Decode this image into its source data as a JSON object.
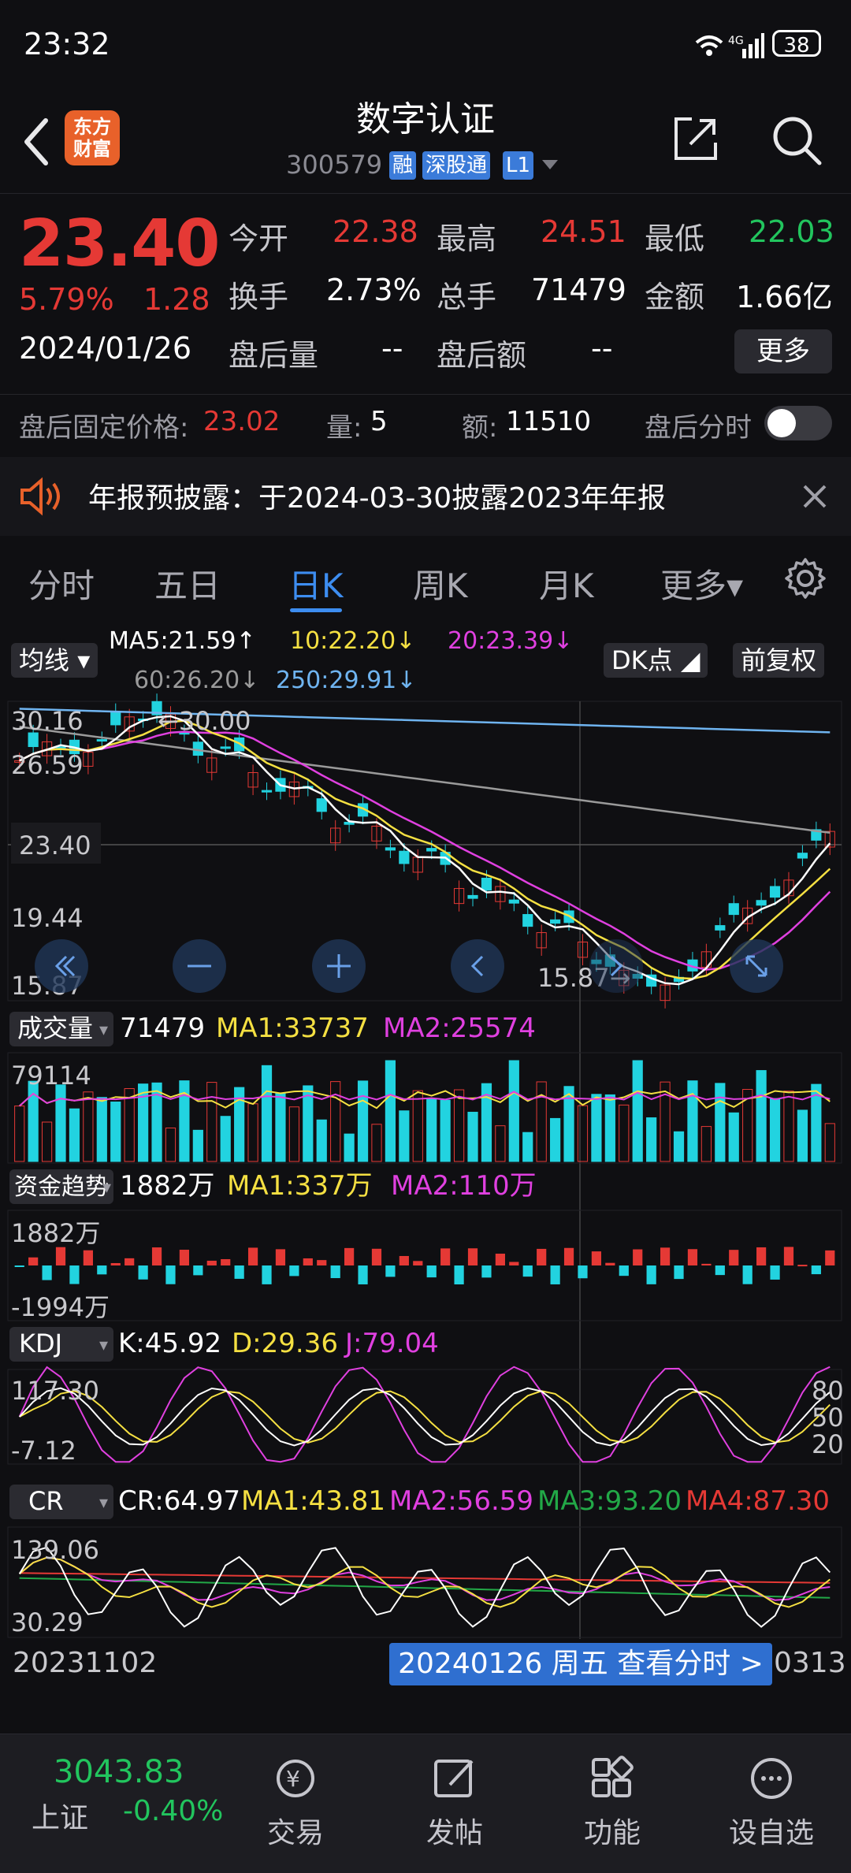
{
  "status": {
    "time": "23:32",
    "network": "4G",
    "battery": "38"
  },
  "header": {
    "title": "数字认证",
    "code": "300579",
    "tags": [
      "融",
      "深股通",
      "L1"
    ],
    "logo_text": "东方财富"
  },
  "quote": {
    "price": "23.40",
    "pct": "5.79%",
    "change": "1.28",
    "date": "2024/01/26",
    "open_label": "今开",
    "open": "22.38",
    "high_label": "最高",
    "high": "24.51",
    "low_label": "最低",
    "low": "22.03",
    "turnover_label": "换手",
    "turnover": "2.73%",
    "volume_label": "总手",
    "volume": "71479",
    "amount_label": "金额",
    "amount": "1.66亿",
    "ah_vol_label": "盘后量",
    "ah_vol": "--",
    "ah_amt_label": "盘后额",
    "ah_amt": "--",
    "more": "更多"
  },
  "after_hours": {
    "price_label": "盘后固定价格:",
    "price": "23.02",
    "qty_label": "量:",
    "qty": "5",
    "amt_label": "额:",
    "amt": "11510",
    "toggle_label": "盘后分时"
  },
  "notice": {
    "text": "年报预披露：于2024-03-30披露2023年年报"
  },
  "tabs": [
    "分时",
    "五日",
    "日K",
    "周K",
    "月K",
    "更多▾"
  ],
  "active_tab": "日K",
  "ma_legend": {
    "chip": "均线",
    "ma5": "MA5:21.59↑",
    "ma10": "10:22.20↓",
    "ma20": "20:23.39↓",
    "ma60": "60:26.20↓",
    "ma250": "250:29.91↓",
    "dk": "DK点",
    "adjust": "前复权"
  },
  "kline": {
    "top": "30.16",
    "l2": "26.59",
    "current": "23.40",
    "l3": "19.44",
    "bottom": "15.87",
    "high_mark": "←30.00",
    "low_mark": "15.87→"
  },
  "volume": {
    "chip": "成交量",
    "value": "71479",
    "ma1": "MA1:33737",
    "ma2": "MA2:25574",
    "axis_top": "79114"
  },
  "fund": {
    "chip": "资金趋势",
    "value": "1882万",
    "ma1": "MA1:337万",
    "ma2": "MA2:110万",
    "axis_top": "1882万",
    "axis_bottom": "-1994万"
  },
  "kdj": {
    "chip": "KDJ",
    "k": "K:45.92",
    "d": "D:29.36",
    "j": "J:79.04",
    "axis_top": "117.30",
    "axis_bottom": "-7.12",
    "r80": "80",
    "r50": "50",
    "r20": "20"
  },
  "cr": {
    "chip": "CR",
    "cr": "CR:64.97",
    "ma1": "MA1:43.81",
    "ma2": "MA2:56.59",
    "ma3": "MA3:93.20",
    "ma4": "MA4:87.30",
    "axis_top": "139.06",
    "axis_bottom": "30.29"
  },
  "dates": {
    "left": "20231102",
    "chip": "20240126 周五 查看分时 >",
    "right": "0313"
  },
  "bottom_nav": {
    "index_value": "3043.83",
    "index_name": "上证",
    "index_change": "-0.40%",
    "trade": "交易",
    "post": "发帖",
    "func": "功能",
    "watch": "设自选"
  },
  "colors": {
    "up": "#e53935",
    "down": "#22c55e",
    "accent": "#3d8df0",
    "ma5": "#ffffff",
    "ma10": "#f5e042",
    "ma20": "#e040e0",
    "ma60": "#9a9a9a",
    "ma250": "#6fb4f0",
    "bear": "#22d3e0"
  }
}
